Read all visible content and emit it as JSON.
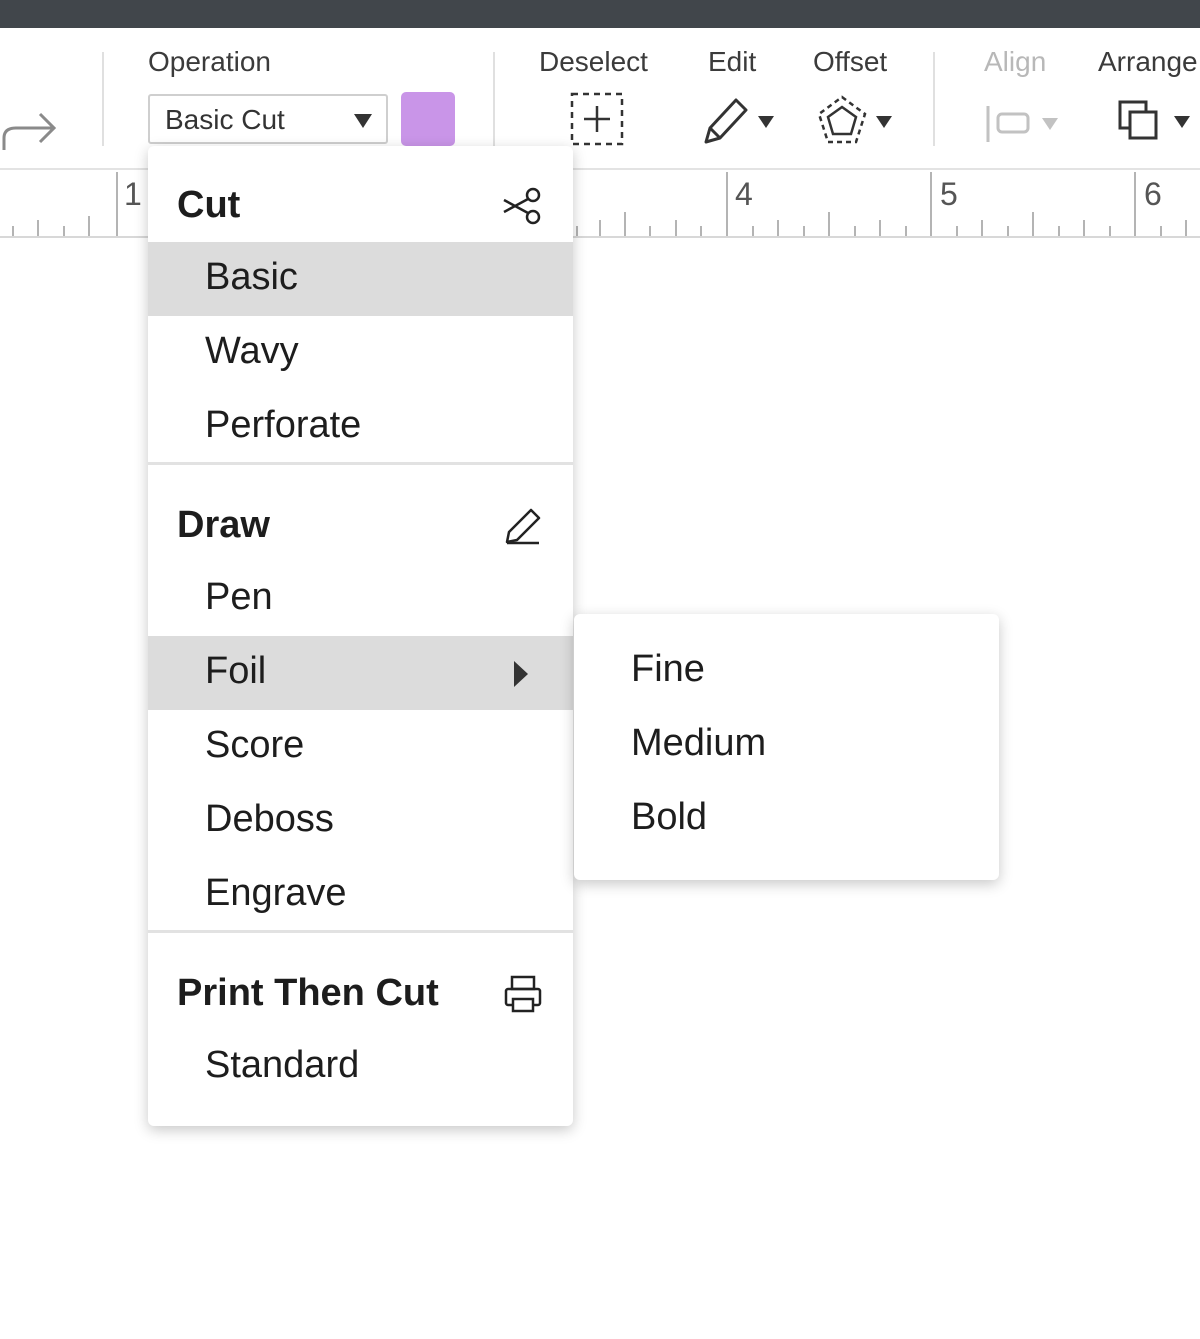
{
  "toolbar": {
    "operation_label": "Operation",
    "operation_value": "Basic Cut",
    "swatch_color": "#c995e8",
    "deselect_label": "Deselect",
    "edit_label": "Edit",
    "offset_label": "Offset",
    "align_label": "Align",
    "arrange_label": "Arrange"
  },
  "ruler": {
    "numbers": [
      "1",
      "4",
      "5",
      "6"
    ]
  },
  "menu": {
    "cut": {
      "title": "Cut",
      "icon": "scissors-icon",
      "items": [
        "Basic",
        "Wavy",
        "Perforate"
      ],
      "highlighted": "Basic"
    },
    "draw": {
      "title": "Draw",
      "icon": "pen-icon",
      "items": [
        "Pen",
        "Foil",
        "Score",
        "Deboss",
        "Engrave"
      ],
      "highlighted": "Foil"
    },
    "print_then_cut": {
      "title": "Print Then Cut",
      "icon": "printer-icon",
      "items": [
        "Standard"
      ]
    }
  },
  "submenu": {
    "items": [
      "Fine",
      "Medium",
      "Bold"
    ]
  }
}
